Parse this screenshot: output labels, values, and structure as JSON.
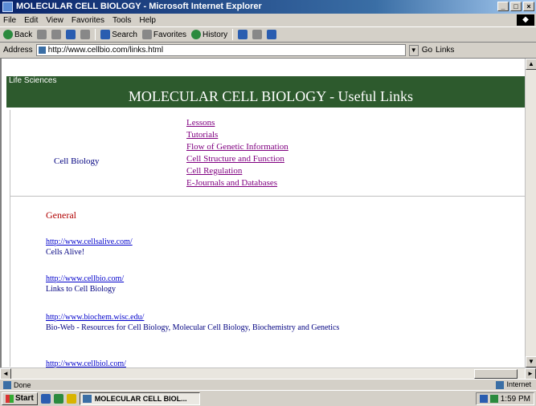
{
  "window": {
    "title": "MOLECULAR CELL BIOLOGY - Microsoft Internet Explorer"
  },
  "menubar": {
    "items": [
      "File",
      "Edit",
      "View",
      "Favorites",
      "Tools",
      "Help"
    ]
  },
  "toolbar": {
    "back": "Back",
    "forward": "",
    "stop": "",
    "refresh": "",
    "home": "",
    "search": "Search",
    "favorites": "Favorites",
    "history": "History",
    "mail": "",
    "print": "",
    "edit": ""
  },
  "addressbar": {
    "label": "Address",
    "url": "http://www.cellbio.com/links.html",
    "go": "Go",
    "links": "Links"
  },
  "page": {
    "top_band": "Life Sciences",
    "title": "MOLECULAR CELL BIOLOGY - Useful Links",
    "nav_left_label": "Cell Biology",
    "nav_links": [
      "Lessons",
      "Tutorials",
      "Flow of Genetic Information",
      "Cell Structure and Function",
      "Cell Regulation",
      "E-Journals and Databases"
    ],
    "section_heading": "General",
    "entries": [
      {
        "url": "http://www.cellsalive.com/",
        "desc": "Cells Alive!"
      },
      {
        "url": "http://www.cellbio.com/",
        "desc": "Links to Cell Biology"
      },
      {
        "url": "http://www.biochem.wisc.edu/",
        "desc": "Bio-Web - Resources for Cell Biology, Molecular Cell Biology, Biochemistry and Genetics"
      },
      {
        "url": "http://www.cellbiol.com/",
        "desc": ""
      }
    ]
  },
  "statusbar": {
    "text": "Done",
    "zone": "Internet"
  },
  "taskbar": {
    "start": "Start",
    "task": "MOLECULAR CELL BIOL...",
    "clock": "1:59 PM"
  }
}
